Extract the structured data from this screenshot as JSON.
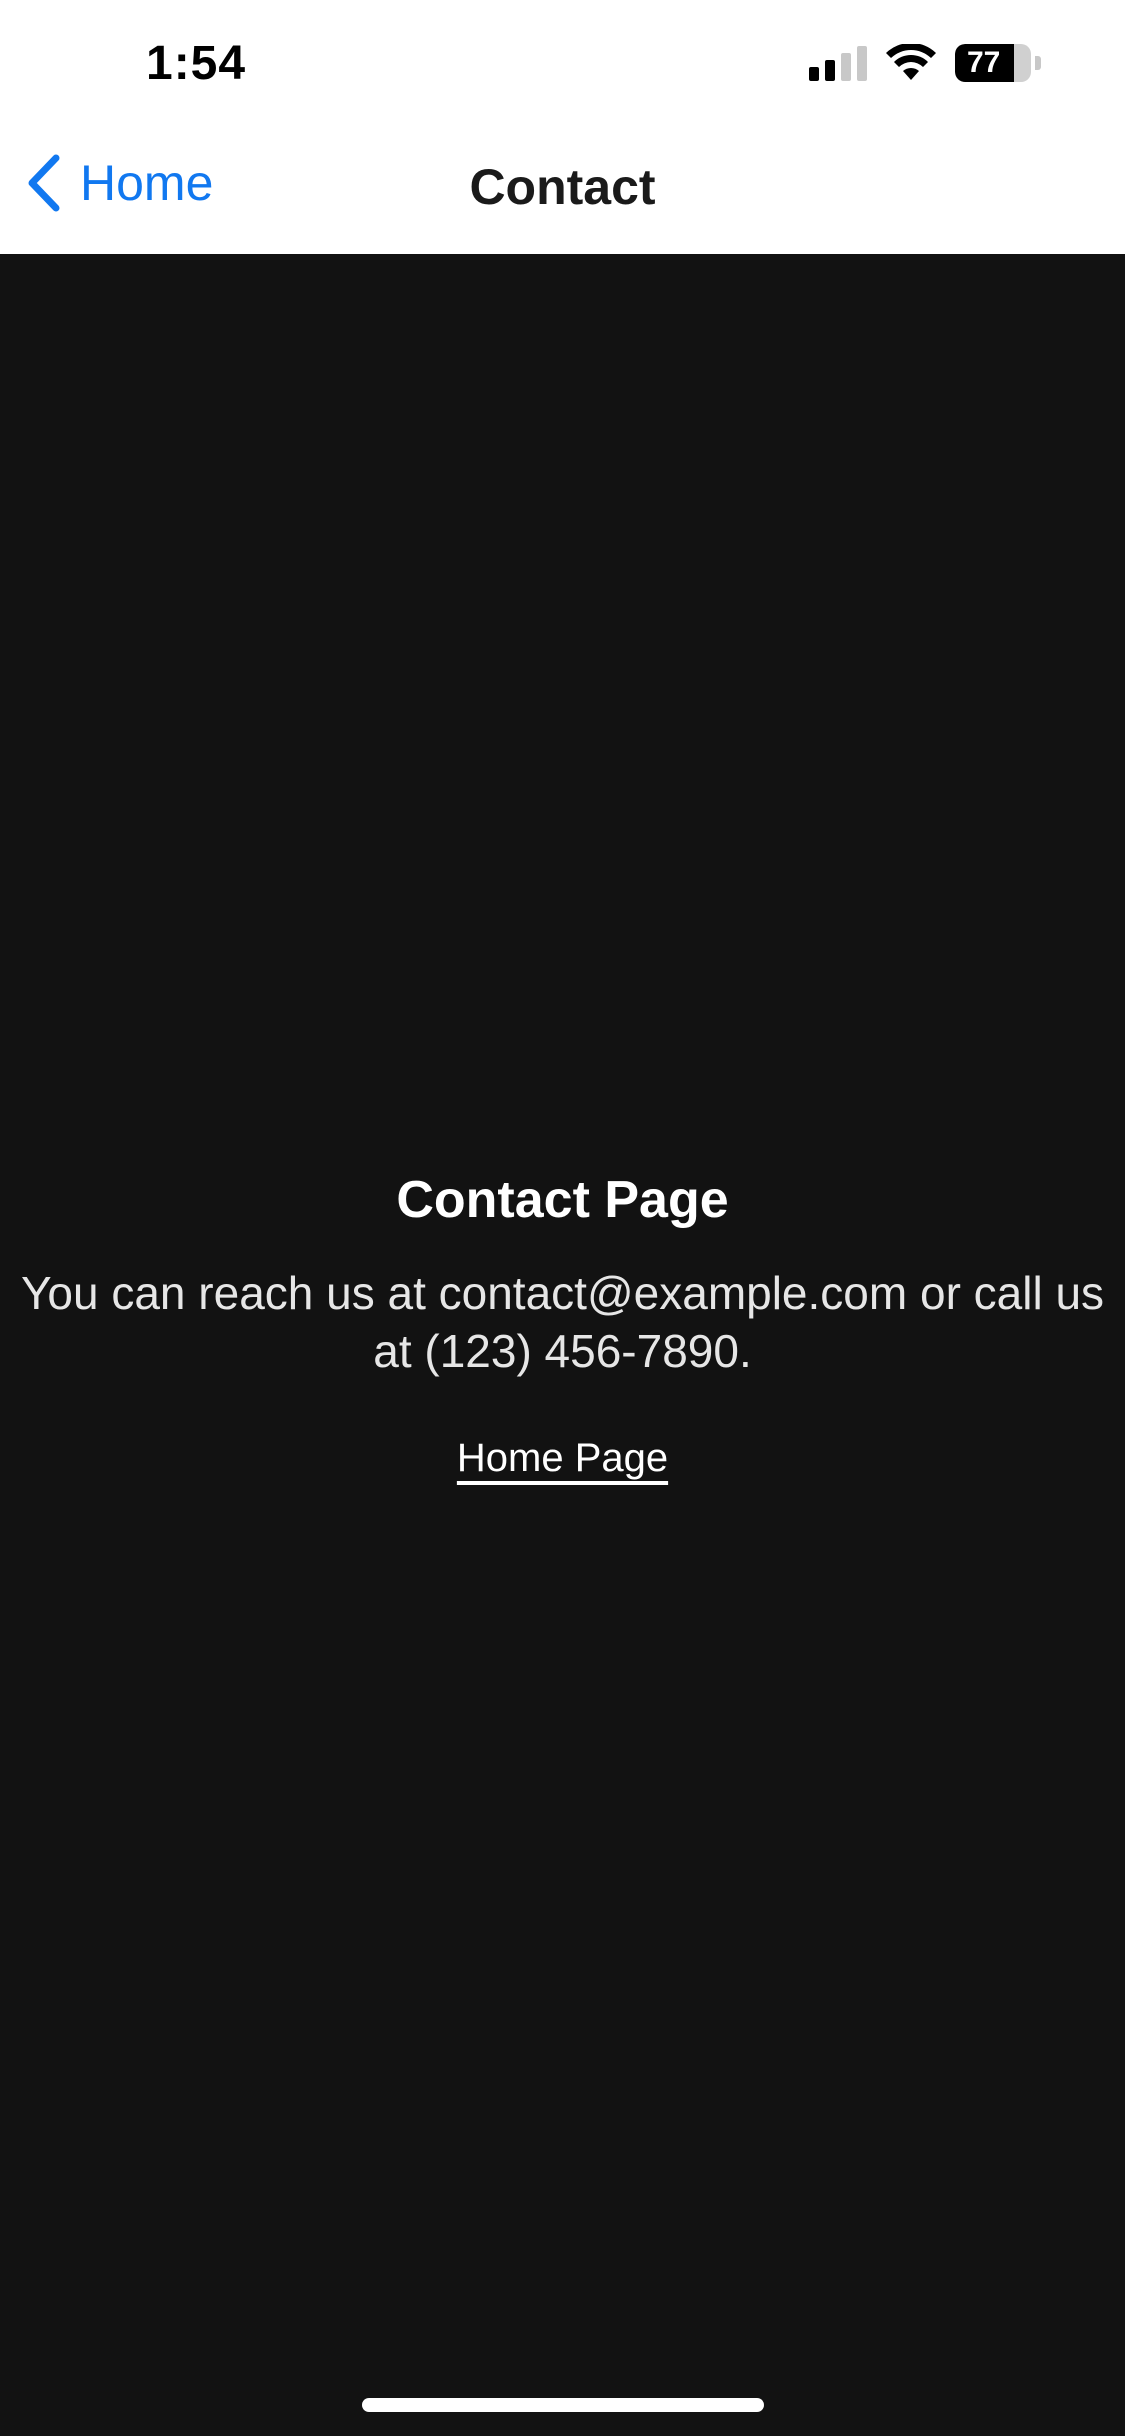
{
  "status_bar": {
    "time": "1:54",
    "battery_level": "77",
    "battery_fraction": 0.77,
    "signal_bars_active": 2,
    "signal_bars_total": 4,
    "icons": [
      "cellular-signal-icon",
      "wifi-icon",
      "battery-icon"
    ]
  },
  "nav": {
    "back_label": "Home",
    "title": "Contact",
    "back_icon": "chevron-left-icon"
  },
  "content": {
    "heading": "Contact Page",
    "body": "You can reach us at contact@example.com or call us at (123) 456-7890.",
    "link_label": "Home Page"
  },
  "colors": {
    "accent": "#1178f0",
    "background": "#121212",
    "header_background": "#ffffff"
  }
}
